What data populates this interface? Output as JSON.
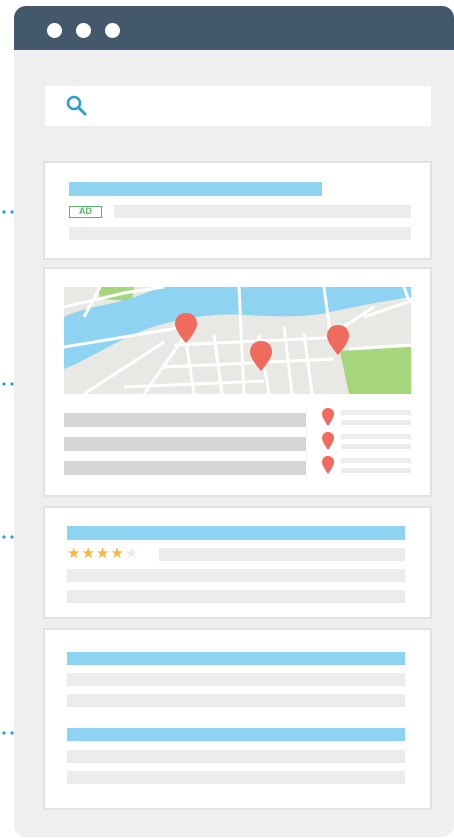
{
  "window": {
    "controls": [
      "close",
      "minimize",
      "maximize"
    ],
    "colors": {
      "titlebar": "#43586b",
      "frame": "#efefef"
    }
  },
  "search": {
    "icon": "search-icon"
  },
  "ad_result": {
    "badge": "AD"
  },
  "map_result": {
    "map_pins": 3,
    "listing_count": 3,
    "pin_icon": "map-pin-icon"
  },
  "review_result": {
    "rating": 4,
    "rating_max": 5,
    "star_color": "#f6b93b"
  },
  "organic_results": {
    "count": 2
  },
  "colors": {
    "title_bar": "#8fd3f3",
    "water": "#8fd3f3",
    "park": "#a6d67b",
    "pin": "#ef6b5d",
    "ad_badge": "#5cb36a",
    "connector_dots": "#2f9fce"
  }
}
